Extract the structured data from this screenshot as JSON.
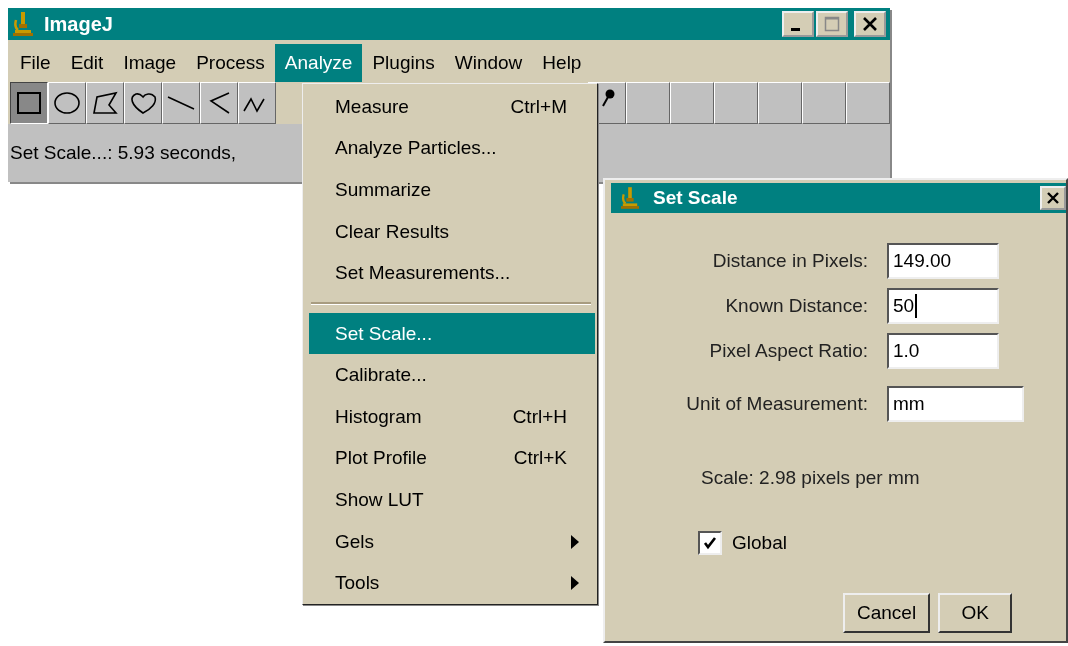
{
  "main_window": {
    "title": "ImageJ",
    "menu_bar": [
      {
        "label": "File",
        "selected": false
      },
      {
        "label": "Edit",
        "selected": false
      },
      {
        "label": "Image",
        "selected": false
      },
      {
        "label": "Process",
        "selected": false
      },
      {
        "label": "Analyze",
        "selected": true
      },
      {
        "label": "Plugins",
        "selected": false
      },
      {
        "label": "Window",
        "selected": false
      },
      {
        "label": "Help",
        "selected": false
      }
    ],
    "toolbar": [
      {
        "kind": "rectangle",
        "selected": true
      },
      {
        "kind": "oval",
        "selected": false
      },
      {
        "kind": "polygon",
        "selected": false
      },
      {
        "kind": "freehand",
        "selected": false
      },
      {
        "kind": "line",
        "selected": false
      },
      {
        "kind": "segmented",
        "selected": false
      },
      {
        "kind": "freeline",
        "selected": false
      },
      {
        "kind": "gap"
      },
      {
        "kind": "pin",
        "selected": false
      },
      {
        "kind": "empty",
        "selected": false
      },
      {
        "kind": "empty",
        "selected": false
      },
      {
        "kind": "empty",
        "selected": false
      },
      {
        "kind": "empty",
        "selected": false
      },
      {
        "kind": "empty",
        "selected": false
      },
      {
        "kind": "empty",
        "selected": false
      }
    ],
    "status": "Set Scale...: 5.93 seconds,"
  },
  "analyze_menu": [
    {
      "kind": "item",
      "label": "Measure",
      "shortcut": "Ctrl+M",
      "selected": false
    },
    {
      "kind": "item",
      "label": "Analyze Particles...",
      "selected": false
    },
    {
      "kind": "item",
      "label": "Summarize",
      "selected": false
    },
    {
      "kind": "item",
      "label": "Clear Results",
      "selected": false
    },
    {
      "kind": "item",
      "label": "Set Measurements...",
      "selected": false
    },
    {
      "kind": "separator"
    },
    {
      "kind": "item",
      "label": "Set Scale...",
      "selected": true
    },
    {
      "kind": "item",
      "label": "Calibrate...",
      "selected": false
    },
    {
      "kind": "item",
      "label": "Histogram",
      "shortcut": "Ctrl+H",
      "selected": false
    },
    {
      "kind": "item",
      "label": "Plot Profile",
      "shortcut": "Ctrl+K",
      "selected": false
    },
    {
      "kind": "item",
      "label": "Show LUT",
      "selected": false
    },
    {
      "kind": "submenu",
      "label": "Gels",
      "selected": false
    },
    {
      "kind": "submenu",
      "label": "Tools",
      "selected": false
    }
  ],
  "dialog": {
    "title": "Set Scale",
    "fields": [
      {
        "label": "Distance in Pixels:",
        "value": "149.00",
        "focused": false
      },
      {
        "label": "Known Distance:",
        "value": "50",
        "focused": true
      },
      {
        "label": "Pixel Aspect Ratio:",
        "value": "1.0",
        "focused": false
      },
      {
        "label": "Unit of Measurement:",
        "value": "mm",
        "focused": false
      }
    ],
    "scale_text": "Scale: 2.98 pixels per mm",
    "global": {
      "label": "Global",
      "checked": true
    },
    "buttons": [
      "Cancel",
      "OK"
    ]
  }
}
